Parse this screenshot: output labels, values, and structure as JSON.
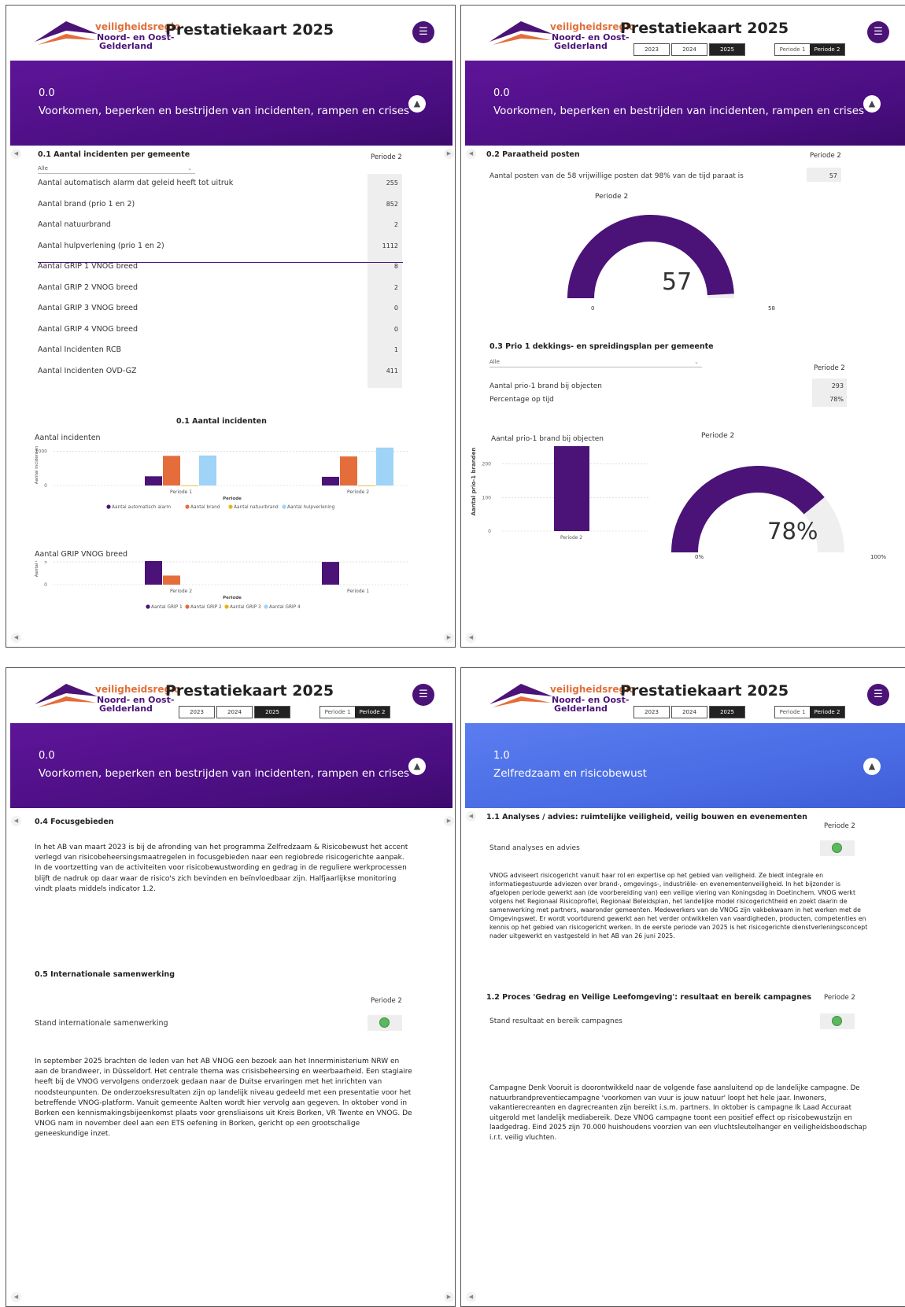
{
  "header": {
    "logo": {
      "line1": "veiligheidsregio",
      "line2": "Noord- en Oost-",
      "line3": "Gelderland"
    },
    "title": "Prestatiekaart 2025",
    "years": [
      "2023",
      "2024",
      "2025"
    ],
    "periods": [
      "Periode 1",
      "Periode 2"
    ]
  },
  "colors": {
    "purple": "#4b1377",
    "orange": "#e46d3b",
    "yellow": "#e7b416",
    "lightblue": "#9fd3f7",
    "green": "#5cb85c",
    "gray": "#eeeeef"
  },
  "icons": {
    "menu": "menu-icon",
    "collapse": "chevron-up-icon",
    "nav_left": "chevron-left-icon",
    "nav_right": "chevron-right-icon",
    "dropdown": "chevron-down-icon",
    "status": "status-dot-icon"
  },
  "banner_purple": {
    "code": "0.0",
    "name": "Voorkomen, beperken en bestrijden van incidenten, rampen en crises"
  },
  "banner_blue": {
    "code": "1.0",
    "name": "Zelfredzaam en risicobewust"
  },
  "p1": {
    "section": "0.1 Aantal incidenten per gemeente",
    "period_label": "Periode 2",
    "filter": "Alle",
    "rows": [
      {
        "label": "Aantal automatisch alarm dat geleid heeft tot uitruk",
        "value": "255"
      },
      {
        "label": "Aantal brand (prio 1 en 2)",
        "value": "852"
      },
      {
        "label": "Aantal natuurbrand",
        "value": "2"
      },
      {
        "label": "Aantal hulpverlening (prio 1 en 2)",
        "value": "1112"
      },
      {
        "label": "Aantal GRIP 1 VNOG breed",
        "value": "8"
      },
      {
        "label": "Aantal GRIP 2 VNOG breed",
        "value": "2"
      },
      {
        "label": "Aantal GRIP 3 VNOG breed",
        "value": "0"
      },
      {
        "label": "Aantal GRIP 4 VNOG breed",
        "value": "0"
      },
      {
        "label": "Aantal Incidenten RCB",
        "value": "1"
      },
      {
        "label": "Aantal Incidenten OVD-GZ",
        "value": "411"
      }
    ],
    "chart_title": "0.1 Aantal incidenten"
  },
  "p2": {
    "section1": "0.2 Paraatheid posten",
    "period_label": "Periode 2",
    "row1": {
      "label": "Aantal posten van de 58 vrijwillige posten dat 98% van de tijd paraat is",
      "value": "57"
    },
    "gauge1": {
      "title": "Periode 2",
      "value": "57",
      "min": "0",
      "max": "58"
    },
    "section2": "0.3 Prio 1 dekkings- en spreidingsplan per gemeente",
    "filter": "Alle",
    "period_label2": "Periode 2",
    "rows2": [
      {
        "label": "Aantal prio-1 brand bij objecten",
        "value": "293"
      },
      {
        "label": "Percentage op tijd",
        "value": "78%"
      }
    ],
    "gauge2": {
      "title": "Periode 2",
      "value": "78%",
      "min": "0%",
      "max": "100%"
    }
  },
  "p3": {
    "section1": "0.4 Focusgebieden",
    "text1": "In het AB van maart 2023 is bij de afronding van het programma Zelfredzaam & Risicobewust het accent verlegd van risicobeheersingsmaatregelen in focusgebieden naar een regiobrede risicogerichte aanpak. In de voortzetting van de activiteiten voor risicobewustwording en gedrag in de reguliere werkprocessen blijft de nadruk op daar waar de risico's zich bevinden en beïnvloedbaar zijn. Halfjaarlijkse monitoring vindt plaats middels indicator 1.2.",
    "section2": "0.5 Internationale samenwerking",
    "period_label": "Periode 2",
    "status_label": "Stand internationale samenwerking",
    "text2": "In september 2025 brachten de leden van het AB VNOG een bezoek aan het Innerministerium NRW en aan de brandweer, in Düsseldorf. Het centrale thema was crisisbeheersing en weerbaarheid. Een stagiaire heeft bij de VNOG vervolgens onderzoek gedaan naar de Duitse ervaringen met het inrichten van noodsteunpunten. De onderzoeksresultaten zijn op landelijk niveau gedeeld met een presentatie voor het betreffende VNOG-platform. Vanuit gemeente Aalten wordt hier vervolg aan gegeven. In oktober vond in Borken een kennismakingsbijeenkomst plaats voor grensliaisons uit Kreis Borken, VR Twente en VNOG. De VNOG nam in november deel aan een ETS oefening in Borken, gericht op een grootschalige geneeskundige inzet."
  },
  "p4": {
    "section1": "1.1 Analyses / advies: ruimtelijke veiligheid, veilig bouwen en evenementen",
    "period_label": "Periode 2",
    "status1": "Stand analyses en advies",
    "text1": "VNOG adviseert risicogericht vanuit haar rol en expertise op het gebied van veiligheid. Ze biedt integrale en informatiegestuurde adviezen over brand-, omgevings-, industriële- en evenementenveiligheid. In het bijzonder is afgelopen periode gewerkt aan (de voorbereiding van) een veilige viering van Koningsdag in Doetinchem. VNOG werkt volgens het Regionaal Risicoprofiel, Regionaal Beleidsplan, het landelijke model risicogerichtheid en zoekt daarin de samenwerking met partners, waaronder gemeenten. Medewerkers van de VNOG zijn vakbekwaam in het werken met de Omgevingswet. Er wordt voortdurend gewerkt aan het verder ontwikkelen van vaardigheden, producten, competenties en kennis op het gebied van risicogericht werken. In de eerste periode van 2025 is het risicogerichte dienstverleningsconcept nader uitgewerkt en vastgesteld in het AB van 26 juni 2025.",
    "section2": "1.2 Proces 'Gedrag en Veilige Leefomgeving': resultaat en bereik campagnes",
    "period_label2": "Periode 2",
    "status2": "Stand resultaat en bereik campagnes",
    "text2": "Campagne Denk Vooruit is doorontwikkeld naar de volgende fase aansluitend op de landelijke campagne. De natuurbrandpreventiecampagne 'voorkomen van vuur is jouw natuur' loopt het hele jaar. Inwoners, vakantierecreanten en dagrecreanten zijn bereikt i.s.m. partners. In oktober is campagne Ik Laad Accuraat uitgerold met landelijk mediabereik. Deze VNOG campagne toont een positief effect op risicobewustzijn en laadgedrag. Eind 2025 zijn 70.000 huishoudens voorzien van een vluchtsleutelhanger en veiligheidsboodschap i.r.t. veilig vluchten."
  },
  "chart_data": [
    {
      "type": "bar",
      "title": "Aantal incidenten",
      "xlabel": "Periode",
      "ylabel": "Aantal incidenten",
      "categories": [
        "Periode 1",
        "Periode 2"
      ],
      "series": [
        {
          "name": "Aantal automatisch alarm",
          "values": [
            270,
            255
          ]
        },
        {
          "name": "Aantal brand",
          "values": [
            870,
            852
          ]
        },
        {
          "name": "Aantal natuurbrand",
          "values": [
            5,
            2
          ]
        },
        {
          "name": "Aantal hulpverlening",
          "values": [
            880,
            1112
          ]
        }
      ],
      "yticks": [
        "0",
        "1000"
      ],
      "ylim": [
        0,
        1200
      ],
      "grid": true,
      "legend": "bottom"
    },
    {
      "type": "bar",
      "title": "Aantal GRIP VNOG breed",
      "xlabel": "Periode",
      "ylabel": "Aantal GRIP",
      "categories": [
        "Periode 2",
        "Periode 1"
      ],
      "series": [
        {
          "name": "Aantal GRIP 1",
          "values": [
            8,
            5
          ]
        },
        {
          "name": "Aantal GRIP 2",
          "values": [
            2,
            0
          ]
        },
        {
          "name": "Aantal GRIP 3",
          "values": [
            0,
            0
          ]
        },
        {
          "name": "Aantal GRIP 4",
          "values": [
            0,
            0
          ]
        }
      ],
      "yticks": [
        "0",
        "5"
      ],
      "ylim": [
        0,
        9
      ],
      "grid": true,
      "legend": "bottom"
    },
    {
      "type": "bar",
      "title": "Aantal prio-1 brand bij objecten",
      "ylabel": "Aantal prio-1 branden",
      "categories": [
        "Periode 2"
      ],
      "series": [
        {
          "name": "",
          "values": [
            293
          ]
        }
      ],
      "yticks": [
        "0",
        "100",
        "200",
        "300"
      ],
      "ylim": [
        0,
        300
      ],
      "grid": true
    }
  ]
}
